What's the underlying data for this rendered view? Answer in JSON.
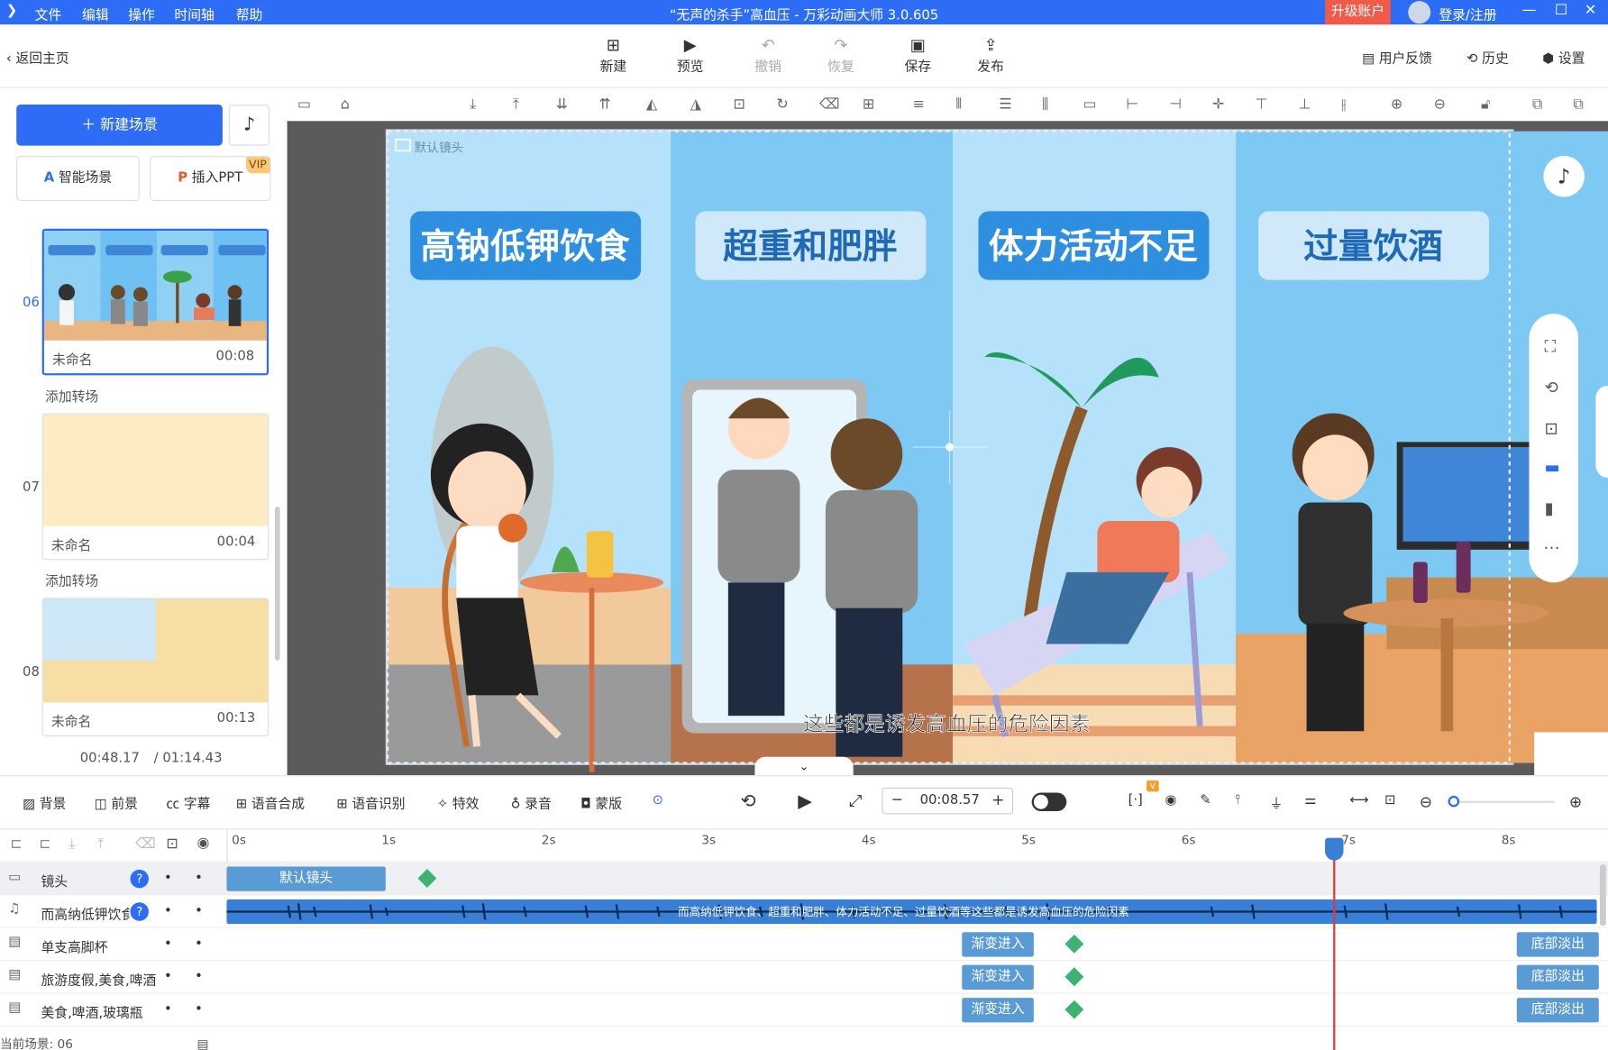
{
  "titlebar": {
    "menus": [
      "文件",
      "编辑",
      "操作",
      "时间轴",
      "帮助"
    ],
    "title": "“无声的杀手”高血压 - 万彩动画大师 3.0.605",
    "upgrade": "升级账户",
    "login": "登录/注册"
  },
  "toolbar": {
    "back": "返回主页",
    "buttons": [
      "新建",
      "预览",
      "撤销",
      "恢复",
      "保存",
      "发布"
    ],
    "feedback": "用户反馈",
    "history": "历史",
    "settings": "设置"
  },
  "left": {
    "new_scene": "新建场景",
    "smart_scene": "智能场景",
    "insert_ppt": "插入PPT",
    "vip": "VIP",
    "scenes": [
      {
        "index": "06",
        "name": "未命名",
        "time": "00:08"
      },
      {
        "index": "07",
        "name": "未命名",
        "time": "00:04"
      },
      {
        "index": "08",
        "name": "未命名",
        "time": "00:13"
      }
    ],
    "add_transition": "添加转场",
    "current_time": "00:48.17",
    "total_time": "/ 01:14.43"
  },
  "canvas": {
    "camera_label": "默认镜头",
    "panels": [
      "高钠低钾饮食",
      "超重和肥胖",
      "体力活动不足",
      "过量饮酒"
    ],
    "subtitle": "这些都是诱发高血压的危险因素"
  },
  "timeline_controls": {
    "items": [
      "背景",
      "前景",
      "字幕",
      "语音合成",
      "语音识别",
      "特效",
      "录音",
      "蒙版"
    ],
    "time": "00:08.57"
  },
  "timeline": {
    "ruler": [
      "0s",
      "1s",
      "2s",
      "3s",
      "4s",
      "5s",
      "6s",
      "7s",
      "8s"
    ],
    "tracks": [
      {
        "name": "镜头",
        "clip": "默认镜头"
      },
      {
        "name": "而高纳低钾饮食超",
        "audio_text": "而高纳低钾饮食、超重和肥胖、体力活动不足、过量饮酒等这些都是诱发高血压的危险因素"
      },
      {
        "name": "单支高脚杯",
        "in": "渐变进入",
        "out": "底部淡出"
      },
      {
        "name": "旅游度假,美食,啤酒",
        "in": "渐变进入",
        "out": "底部淡出"
      },
      {
        "name": "美食,啤酒,玻璃瓶",
        "in": "渐变进入",
        "out": "底部淡出"
      }
    ],
    "current_scene": "当前场景: 06"
  },
  "colors": {
    "accent": "#2d6df6",
    "upgrade": "#f05a48",
    "playhead": "#e53935"
  }
}
